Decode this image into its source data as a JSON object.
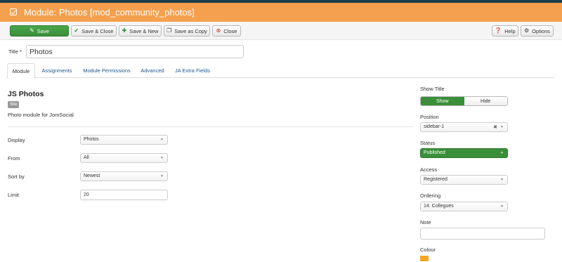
{
  "header": {
    "title": "Module: Photos [mod_community_photos]",
    "icon": "check-square-icon"
  },
  "toolbar": {
    "save": "Save",
    "save_close": "Save & Close",
    "save_new": "Save & New",
    "save_copy": "Save as Copy",
    "close": "Close",
    "help": "Help",
    "options": "Options"
  },
  "form": {
    "title_label": "Title *",
    "title_value": "Photos"
  },
  "tabs": [
    "Module",
    "Assignments",
    "Module Permissions",
    "Advanced",
    "JA Extra Fields"
  ],
  "module": {
    "name": "JS Photos",
    "badge": "Site",
    "description": "Photo module for JomSocial"
  },
  "fields": {
    "display": {
      "label": "Display",
      "value": "Photos"
    },
    "from": {
      "label": "From",
      "value": "All"
    },
    "sort": {
      "label": "Sort by",
      "value": "Newest"
    },
    "limit": {
      "label": "Limit",
      "value": "20"
    }
  },
  "sidebar": {
    "show_title": {
      "label": "Show Title",
      "show": "Show",
      "hide": "Hide",
      "selected": "Show"
    },
    "position": {
      "label": "Position",
      "value": "sidebar-1"
    },
    "status": {
      "label": "Status",
      "value": "Published"
    },
    "access": {
      "label": "Access",
      "value": "Registered"
    },
    "ordering": {
      "label": "Ordering",
      "value": "14. Collegues"
    },
    "note": {
      "label": "Note",
      "value": ""
    },
    "colour": {
      "label": "Colour",
      "value": "#f5a623"
    }
  },
  "colors": {
    "header_bg": "#f5a04e",
    "top_strip": "#1c3d4a",
    "success": "#3a8f3a",
    "link": "#225a8a"
  }
}
